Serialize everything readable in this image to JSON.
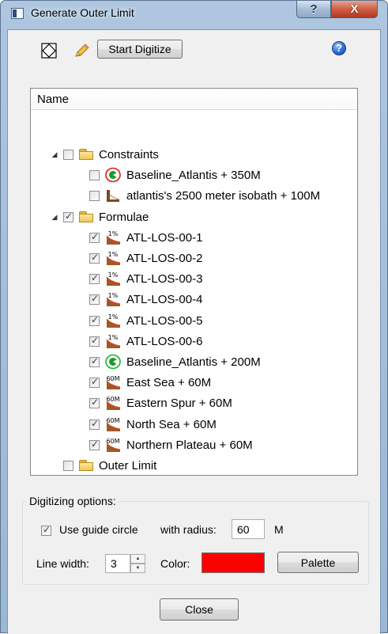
{
  "window": {
    "title": "Generate Outer Limit",
    "help_caption": "?",
    "close_caption": "X"
  },
  "toolbar": {
    "shape_tool_icon": "diamond-square-icon",
    "pencil_icon": "pencil-icon",
    "start_digitize_label": "Start Digitize",
    "help_icon": "help-icon",
    "help_glyph": "?"
  },
  "tree": {
    "header": "Name",
    "groups": [
      {
        "label": "Constraints",
        "checked": false,
        "expanded": true,
        "items": [
          {
            "label": "Baseline_Atlantis + 350M",
            "checked": false,
            "icon": "baseline-red-icon"
          },
          {
            "label": "atlantis's 2500 meter isobath + 100M",
            "checked": false,
            "icon": "isobath-icon"
          }
        ]
      },
      {
        "label": "Formulae",
        "checked": true,
        "expanded": true,
        "items": [
          {
            "label": "ATL-LOS-00-1",
            "checked": true,
            "icon": "formula-percent-icon",
            "icon_text": "1%"
          },
          {
            "label": "ATL-LOS-00-2",
            "checked": true,
            "icon": "formula-percent-icon",
            "icon_text": "1%"
          },
          {
            "label": "ATL-LOS-00-3",
            "checked": true,
            "icon": "formula-percent-icon",
            "icon_text": "1%"
          },
          {
            "label": "ATL-LOS-00-4",
            "checked": true,
            "icon": "formula-percent-icon",
            "icon_text": "1%"
          },
          {
            "label": "ATL-LOS-00-5",
            "checked": true,
            "icon": "formula-percent-icon",
            "icon_text": "1%"
          },
          {
            "label": "ATL-LOS-00-6",
            "checked": true,
            "icon": "formula-percent-icon",
            "icon_text": "1%"
          },
          {
            "label": "Baseline_Atlantis + 200M",
            "checked": true,
            "icon": "baseline-green-icon"
          },
          {
            "label": "East Sea + 60M",
            "checked": true,
            "icon": "formula-60m-icon",
            "icon_text": "60M"
          },
          {
            "label": "Eastern Spur + 60M",
            "checked": true,
            "icon": "formula-60m-icon",
            "icon_text": "60M"
          },
          {
            "label": "North Sea + 60M",
            "checked": true,
            "icon": "formula-60m-icon",
            "icon_text": "60M"
          },
          {
            "label": "Northern Plateau + 60M",
            "checked": true,
            "icon": "formula-60m-icon",
            "icon_text": "60M"
          }
        ]
      },
      {
        "label": "Outer Limit",
        "checked": false,
        "expanded": false,
        "items": []
      }
    ]
  },
  "digitizing": {
    "legend": "Digitizing options:",
    "use_guide_circle_label": "Use guide circle",
    "use_guide_circle": true,
    "with_radius_label": "with radius:",
    "radius_value": "60",
    "radius_unit": "M",
    "line_width_label": "Line width:",
    "line_width_value": "3",
    "color_label": "Color:",
    "color_value": "#ff0000",
    "palette_label": "Palette"
  },
  "footer": {
    "close_label": "Close"
  }
}
